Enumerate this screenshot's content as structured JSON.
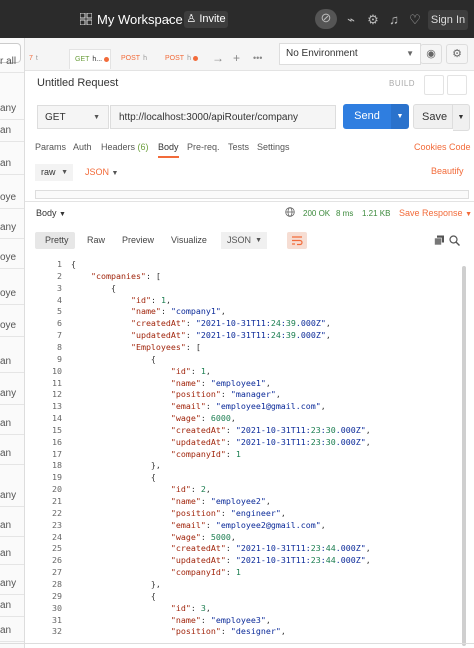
{
  "topbar": {
    "workspace_title": "My Workspace",
    "invite_label": "Invite",
    "signin_label": "Sign In",
    "icons": [
      "grid-icon",
      "sync-off-icon",
      "satellite-icon",
      "settings-icon",
      "bell-icon",
      "heart-icon"
    ]
  },
  "sidebar": {
    "items": [
      "r all",
      "any",
      "an",
      "an",
      "oye",
      "any",
      "oye",
      "oye",
      "oye",
      "an",
      "any",
      "an",
      "an",
      "any",
      "an",
      "an",
      "any",
      "an",
      "an"
    ]
  },
  "tabs": {
    "items": [
      {
        "method": "7",
        "label": "t"
      },
      {
        "method": "GET",
        "label": "h..."
      },
      {
        "method": "POST",
        "label": "h"
      },
      {
        "method": "POST",
        "label": "h"
      }
    ],
    "controls": [
      "→",
      "+",
      "•••"
    ]
  },
  "environment": {
    "label": "No Environment"
  },
  "request": {
    "title": "Untitled Request",
    "build_label": "BUILD",
    "method": "GET",
    "url": "http://localhost:3000/apiRouter/company",
    "send_label": "Send",
    "save_label": "Save"
  },
  "request_tabs": {
    "params": "Params",
    "auth": "Auth",
    "headers": "Headers",
    "headers_count": "(6)",
    "body": "Body",
    "prereq": "Pre-req.",
    "tests": "Tests",
    "settings": "Settings",
    "cookies": "Cookies",
    "code": "Code"
  },
  "body_format": {
    "mode": "raw",
    "type": "JSON",
    "beautify": "Beautify"
  },
  "response": {
    "label": "Body",
    "status": "200 OK",
    "time": "8 ms",
    "size": "1.21 KB",
    "save_response": "Save Response",
    "views": [
      "Pretty",
      "Raw",
      "Preview",
      "Visualize"
    ],
    "format": "JSON"
  },
  "code_lines": [
    {
      "n": "1",
      "t": "{"
    },
    {
      "n": "2",
      "t": "    \"companies\": ["
    },
    {
      "n": "3",
      "t": "        {"
    },
    {
      "n": "4",
      "t": "            \"id\": 1,"
    },
    {
      "n": "5",
      "t": "            \"name\": \"company1\","
    },
    {
      "n": "6",
      "t": "            \"createdAt\": \"2021-10-31T11:24:39.000Z\","
    },
    {
      "n": "7",
      "t": "            \"updatedAt\": \"2021-10-31T11:24:39.000Z\","
    },
    {
      "n": "8",
      "t": "            \"Employees\": ["
    },
    {
      "n": "9",
      "t": "                {"
    },
    {
      "n": "10",
      "t": "                    \"id\": 1,"
    },
    {
      "n": "11",
      "t": "                    \"name\": \"employee1\","
    },
    {
      "n": "12",
      "t": "                    \"position\": \"manager\","
    },
    {
      "n": "13",
      "t": "                    \"email\": \"employee1@gmail.com\","
    },
    {
      "n": "14",
      "t": "                    \"wage\": 6000,"
    },
    {
      "n": "15",
      "t": "                    \"createdAt\": \"2021-10-31T11:23:30.000Z\","
    },
    {
      "n": "16",
      "t": "                    \"updatedAt\": \"2021-10-31T11:23:30.000Z\","
    },
    {
      "n": "17",
      "t": "                    \"companyId\": 1"
    },
    {
      "n": "18",
      "t": "                },"
    },
    {
      "n": "19",
      "t": "                {"
    },
    {
      "n": "20",
      "t": "                    \"id\": 2,"
    },
    {
      "n": "21",
      "t": "                    \"name\": \"employee2\","
    },
    {
      "n": "22",
      "t": "                    \"position\": \"engineer\","
    },
    {
      "n": "23",
      "t": "                    \"email\": \"employee2@gmail.com\","
    },
    {
      "n": "24",
      "t": "                    \"wage\": 5000,"
    },
    {
      "n": "25",
      "t": "                    \"createdAt\": \"2021-10-31T11:23:44.000Z\","
    },
    {
      "n": "26",
      "t": "                    \"updatedAt\": \"2021-10-31T11:23:44.000Z\","
    },
    {
      "n": "27",
      "t": "                    \"companyId\": 1"
    },
    {
      "n": "28",
      "t": "                },"
    },
    {
      "n": "29",
      "t": "                {"
    },
    {
      "n": "30",
      "t": "                    \"id\": 3,"
    },
    {
      "n": "31",
      "t": "                    \"name\": \"employee3\","
    },
    {
      "n": "32",
      "t": "                    \"position\": \"designer\","
    }
  ],
  "colors": {
    "accent": "#f26b3a",
    "send": "#2f7ee0",
    "ok": "#3c8a3c"
  }
}
